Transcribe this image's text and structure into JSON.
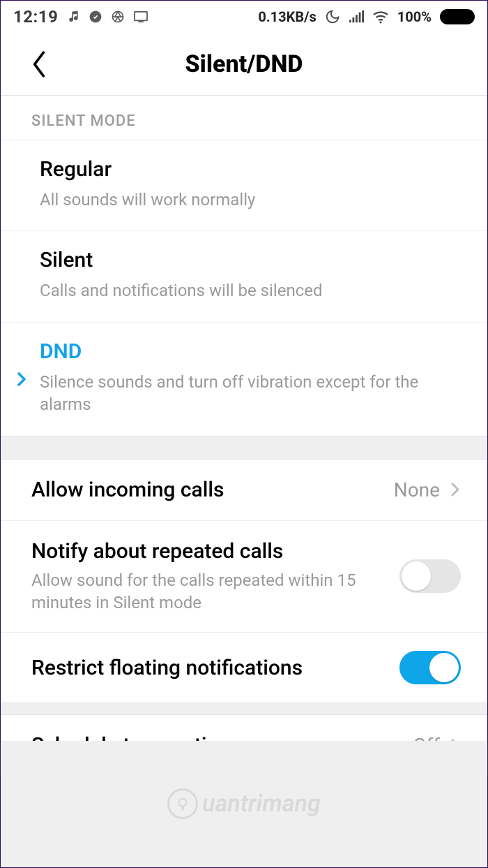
{
  "statusbar": {
    "time": "12:19",
    "kbs": "0.13KB/s",
    "battery_pct": "100%"
  },
  "header": {
    "title": "Silent/DND"
  },
  "silent_mode": {
    "label": "SILENT MODE",
    "options": {
      "regular": {
        "title": "Regular",
        "desc": "All sounds will work normally"
      },
      "silent": {
        "title": "Silent",
        "desc": "Calls and notifications will be silenced"
      },
      "dnd": {
        "title": "DND",
        "desc": "Silence sounds and turn off vibration except for the alarms"
      }
    },
    "selected": "dnd"
  },
  "dnd_settings": {
    "allow_calls": {
      "title": "Allow incoming calls",
      "value": "None"
    },
    "repeated": {
      "title": "Notify about repeated calls",
      "desc": "Allow sound for the calls repeated within 15 minutes in Silent mode",
      "enabled": false
    },
    "restrict": {
      "title": "Restrict floating notifications",
      "enabled": true
    }
  },
  "schedule": {
    "title": "Schedule turn on time",
    "value": "Off"
  },
  "watermark": "uantrimang",
  "colors": {
    "accent": "#0ea5e9",
    "selected_text": "#14a2ea"
  }
}
